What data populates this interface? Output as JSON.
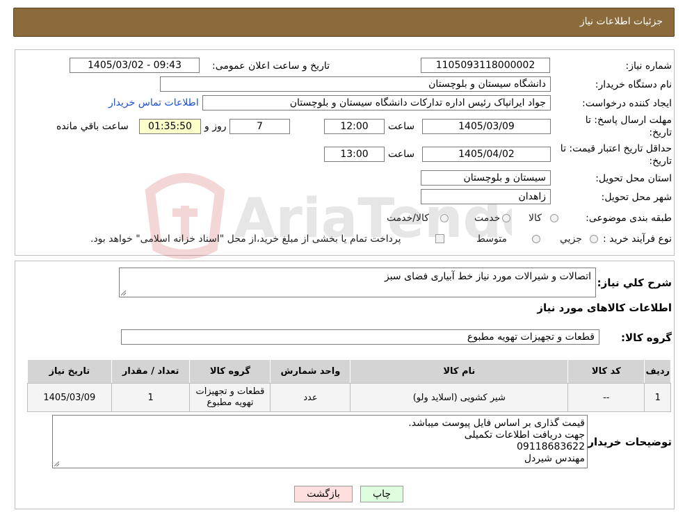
{
  "header": {
    "title": "جزئیات اطلاعات نیاز"
  },
  "watermark": {
    "text": "AriaTender.neT"
  },
  "form": {
    "need_number_label": "شماره نیاز:",
    "need_number": "1105093118000002",
    "announce_label": "تاریخ و ساعت اعلان عمومی:",
    "announce_value": "1405/03/02 - 09:43",
    "buyer_org_label": "نام دستگاه خریدار:",
    "buyer_org": "دانشگاه سیستان و بلوچستان",
    "creator_label": "ایجاد کننده درخواست:",
    "creator": "جواد ایرانپاک رئیس اداره تدارکات دانشگاه سیستان و بلوچستان",
    "contact_link": "اطلاعات تماس خریدار",
    "deadline_label_1": "مهلت ارسال پاسخ: تا",
    "deadline_label_2": "تاریخ:",
    "deadline_date": "1405/03/09",
    "time_label": "ساعت",
    "deadline_time": "12:00",
    "days_value": "7",
    "days_label": "روز و",
    "remaining_time": "01:35:50",
    "remaining_label": "ساعت باقي مانده",
    "validity_label_1": "حداقل تاریخ اعتبار قیمت: تا",
    "validity_label_2": "تاریخ:",
    "validity_date": "1405/04/02",
    "validity_time": "13:00",
    "province_label": "استان محل تحویل:",
    "province": "سیستان و بلوچستان",
    "city_label": "شهر محل تحویل:",
    "city": "زاهدان",
    "category_label": "طبقه بندی موضوعی:",
    "category_options": [
      "کالا",
      "خدمت",
      "کالا/خدمت"
    ],
    "process_label": "نوع فرآیند خرید :",
    "process_options": [
      "جزیي",
      "متوسط"
    ],
    "process_note": "پرداخت تمام یا بخشی از مبلغ خرید،از محل \"اسناد خزانه اسلامی\" خواهد بود."
  },
  "details": {
    "summary_label": "شرح کلي نياز:",
    "summary": "اتصالات و شیرالات مورد نیاز خط آبیاری فضای سبز",
    "items_heading": "اطلاعات کالاهای مورد نیاز",
    "group_label": "گروه کالا:",
    "group_value": "قطعات و تجهیزات تهویه مطبوع",
    "table": {
      "headers": [
        "ردیف",
        "کد کالا",
        "نام کالا",
        "واحد شمارش",
        "گروه کالا",
        "تعداد / مقدار",
        "تاریخ نیاز"
      ],
      "rows": [
        [
          "1",
          "--",
          "شیر کشویی (اسلاید ولو)",
          "عدد",
          "قطعات و تجهیزات تهویه مطبوع",
          "1",
          "1405/03/09"
        ]
      ]
    },
    "buyer_notes_label": "توضیحات خریدار:",
    "buyer_notes": [
      "قیمت گذاری بر اساس فایل پیوست میباشد.",
      "جهت دریافت اطلاعات تکمیلی",
      "09118683622",
      "مهندس شیردل"
    ]
  },
  "buttons": {
    "print": "چاپ",
    "back": "بازگشت"
  },
  "colors": {
    "header_bg": "#8b6a3b",
    "link": "#1a4fd4",
    "print_bg": "#ddffdd",
    "back_bg": "#ffdede"
  }
}
